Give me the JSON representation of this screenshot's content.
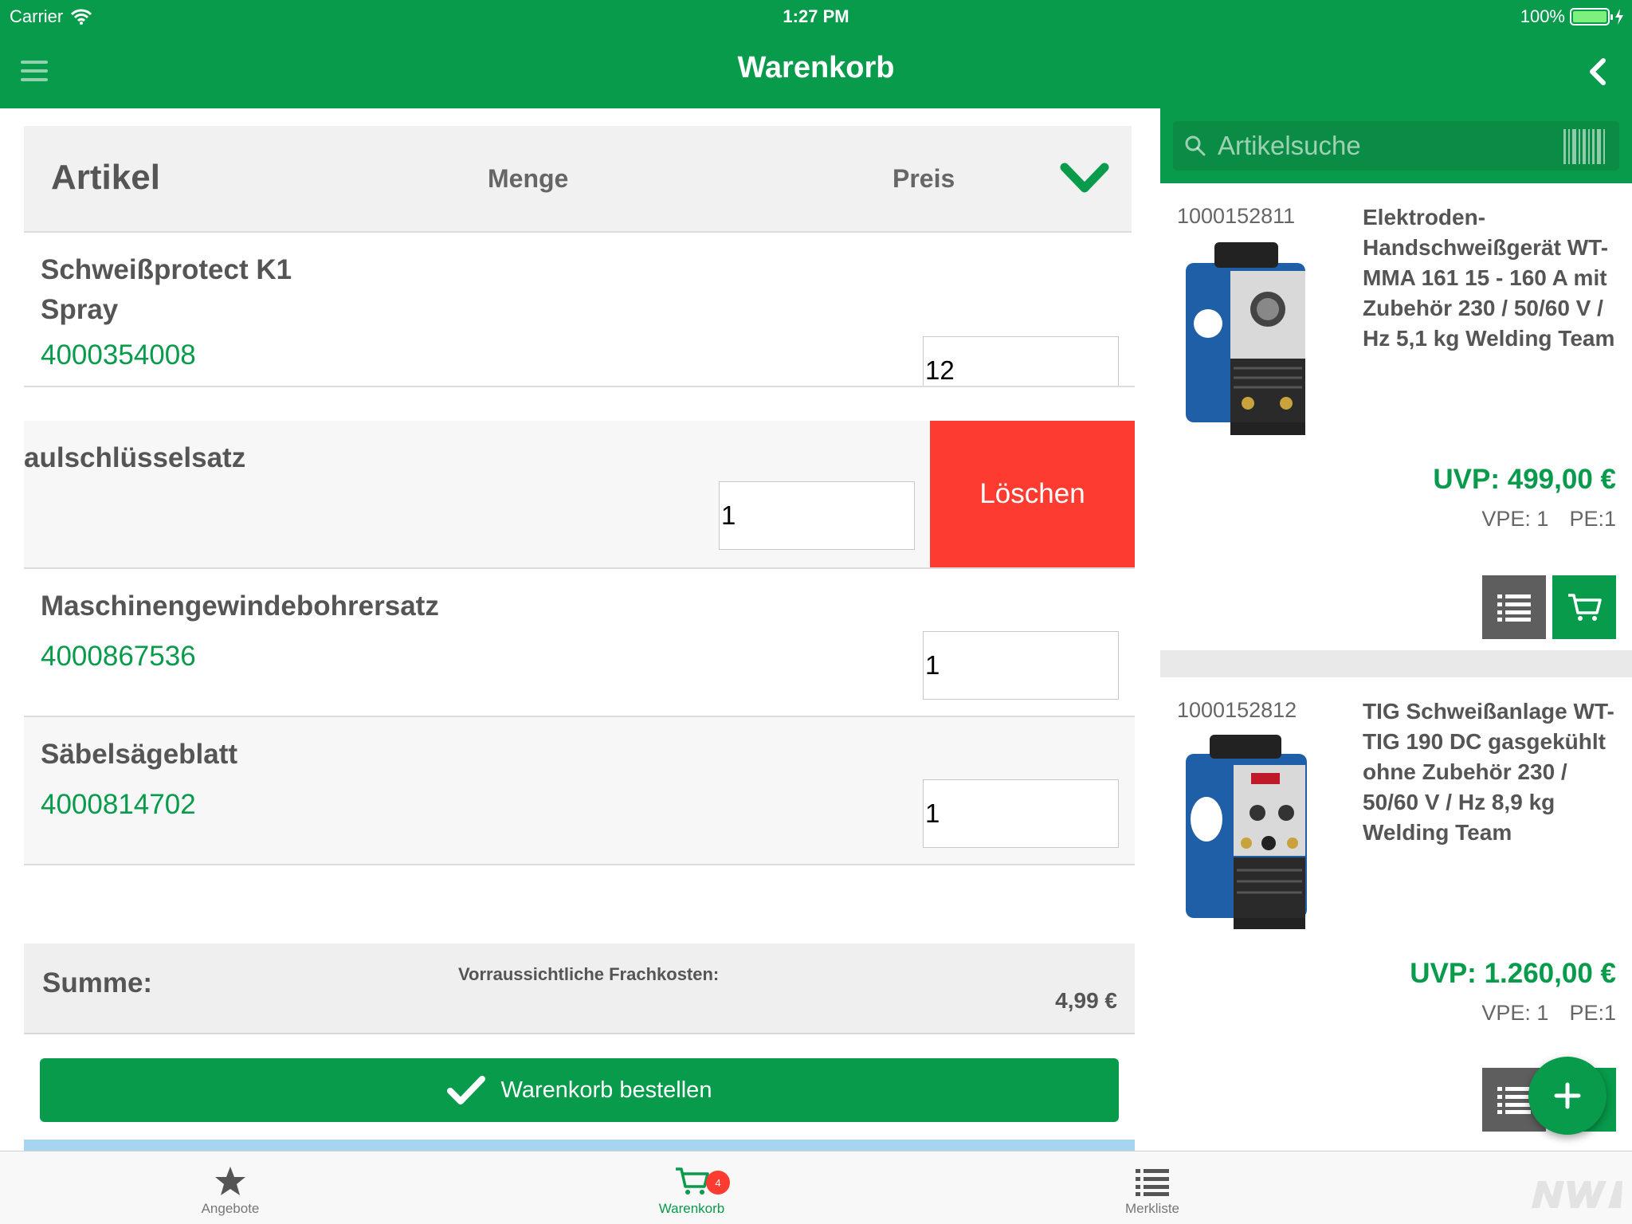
{
  "status_bar": {
    "carrier": "Carrier",
    "time": "1:27 PM",
    "battery": "100%"
  },
  "nav": {
    "title": "Warenkorb"
  },
  "cart_table": {
    "headers": {
      "article": "Artikel",
      "quantity": "Menge",
      "price": "Preis"
    },
    "rows": [
      {
        "name_line1": "Schweißprotect K1",
        "name_line2": "Spray",
        "code": "4000354008",
        "qty": "12"
      },
      {
        "name_line1": "aulschlüsselsatz",
        "qty": "1",
        "delete_label": "Löschen"
      },
      {
        "name_line1": "Maschinengewindebohrersatz",
        "code": "4000867536",
        "qty": "1"
      },
      {
        "name_line1": "Säbelsägeblatt",
        "code": "4000814702",
        "qty": "1"
      }
    ]
  },
  "summary": {
    "label": "Summe:",
    "freight_label": "Vorraussichtliche Frachkosten:",
    "freight_value": "4,99 €"
  },
  "order_button": {
    "label": "Warenkorb bestellen"
  },
  "search": {
    "placeholder": "Artikelsuche"
  },
  "products": [
    {
      "article_no": "1000152811",
      "title": "Elektroden-Handschweißgerät WT-MMA 161 15 - 160 A mit Zubehör 230 / 50/60 V / Hz 5,1 kg Welding Team",
      "uvp": "UVP: 499,00 €",
      "vpe": "VPE: 1",
      "pe": "PE:1"
    },
    {
      "article_no": "1000152812",
      "title": "TIG Schweißanlage WT-TIG 190 DC gasgekühlt ohne Zubehör 230 / 50/60 V / Hz 8,9 kg Welding Team",
      "uvp": "UVP: 1.260,00 €",
      "vpe": "VPE: 1",
      "pe": "PE:1"
    }
  ],
  "tabs": [
    {
      "label": "Angebote",
      "icon": "star-icon"
    },
    {
      "label": "Warenkorb",
      "icon": "cart-icon",
      "badge": "4",
      "active": true
    },
    {
      "label": "Merkliste",
      "icon": "list-icon"
    }
  ],
  "colors": {
    "brand_green": "#079b4b",
    "delete_red": "#fd3b30",
    "badge_red": "#fd3b30"
  }
}
